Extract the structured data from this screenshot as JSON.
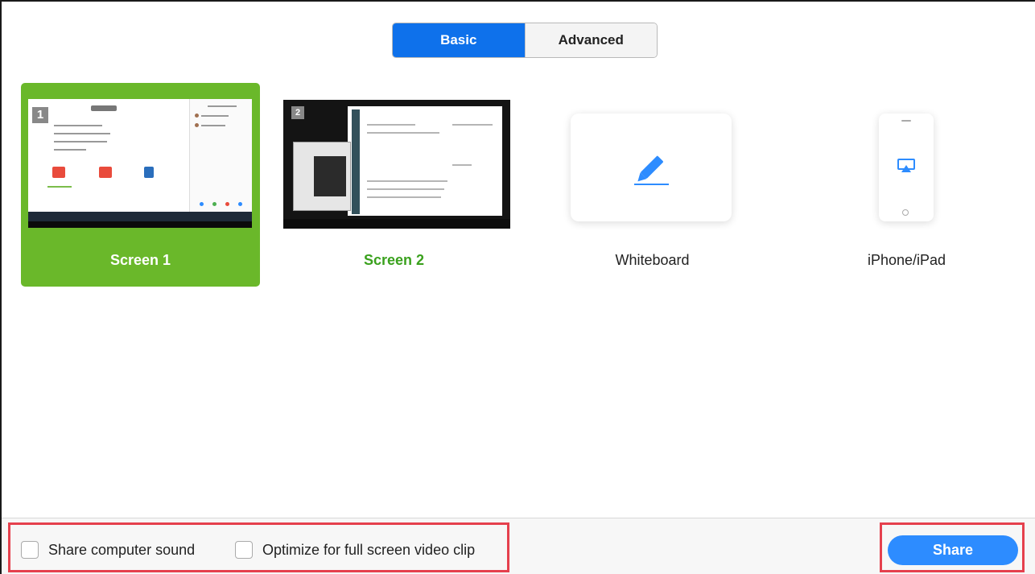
{
  "tabs": [
    {
      "label": "Basic",
      "active": true
    },
    {
      "label": "Advanced",
      "active": false
    }
  ],
  "options": {
    "screen1": {
      "label": "Screen 1",
      "number": "1",
      "selected": true
    },
    "screen2": {
      "label": "Screen 2",
      "number": "2",
      "selected": false
    },
    "whiteboard": {
      "label": "Whiteboard",
      "icon": "pencil-icon"
    },
    "iphone": {
      "label": "iPhone/iPad",
      "icon": "airplay-icon"
    }
  },
  "footer": {
    "share_sound_label": "Share computer sound",
    "optimize_label": "Optimize for full screen video clip",
    "share_button": "Share"
  },
  "colors": {
    "accent_blue": "#0e71eb",
    "selected_green": "#6ab82a",
    "label_green": "#3aa11d",
    "share_blue": "#2d8cff",
    "highlight_red": "#e5404d"
  }
}
